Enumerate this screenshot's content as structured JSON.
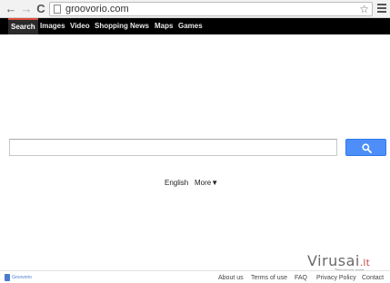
{
  "browser": {
    "url": "groovorio.com",
    "back_glyph": "←",
    "forward_glyph": "→",
    "reload_glyph": "C",
    "star_glyph": "☆"
  },
  "nav": {
    "items": [
      "Search",
      "Images",
      "Video",
      "Shopping",
      "News",
      "Maps",
      "Games"
    ],
    "active": "Search"
  },
  "search": {
    "query": "",
    "button_color": "#4d8ef8"
  },
  "language": {
    "current": "English",
    "more": "More▼"
  },
  "watermark": {
    "name": "Virusai",
    "tld": ".lt",
    "sub": "2spyware.com"
  },
  "footer": {
    "logo": "Groovorio",
    "links": [
      "About us",
      "Terms of use",
      "FAQ",
      "Privacy Policy",
      "Contact"
    ]
  },
  "colors": {
    "navbar_bg": "#000000",
    "active_tab_accent": "#dd4b39",
    "search_button": "#4d8ef8",
    "logo": "#4a7bd1"
  }
}
